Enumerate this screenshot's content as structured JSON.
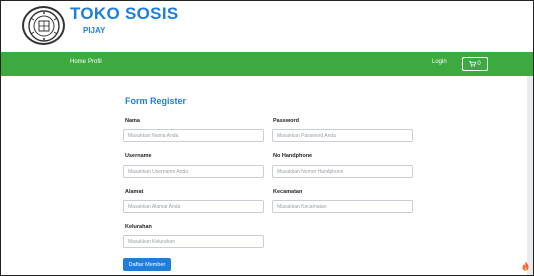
{
  "brand": {
    "title": "TOKO SOSIS",
    "subtitle": "PIJAY",
    "logo_icon": "emblem-seal-icon"
  },
  "nav": {
    "items": [
      {
        "label": "Home"
      },
      {
        "label": "Profil"
      }
    ],
    "login_label": "Login",
    "cart_count": "0",
    "cart_icon": "shopping-cart-icon",
    "color": "#3daa3f"
  },
  "form": {
    "title": "Form Register",
    "fields": {
      "nama": {
        "label": "Nama",
        "placeholder": "Masukkan Nama Anda",
        "value": ""
      },
      "password": {
        "label": "Password",
        "placeholder": "Masukkan Password Anda",
        "value": ""
      },
      "username": {
        "label": "Username",
        "placeholder": "Masukkan Username Anda",
        "value": ""
      },
      "handphone": {
        "label": "No Handphone",
        "placeholder": "Masukkan Nomor Handphone",
        "value": ""
      },
      "alamat": {
        "label": "Alamat",
        "placeholder": "Masukkan Alamat Anda",
        "value": ""
      },
      "kecamatan": {
        "label": "Kecamatan",
        "placeholder": "Masukkan Kecamatan",
        "value": ""
      },
      "kelurahan": {
        "label": "Kelurahan",
        "placeholder": "Masukkan Kelurahan",
        "value": ""
      }
    },
    "submit_label": "Daftar Member",
    "accent": "#1e7fd9"
  },
  "corner_icon": "flame-icon"
}
